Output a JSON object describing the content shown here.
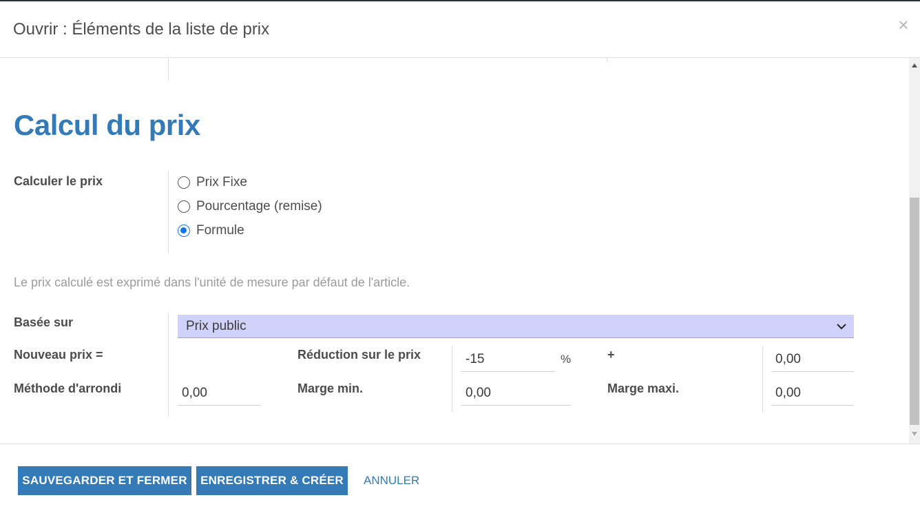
{
  "dialog": {
    "title": "Ouvrir : Éléments de la liste de prix",
    "close_icon": "×"
  },
  "section": {
    "title": "Calcul du prix"
  },
  "compute_price": {
    "label": "Calculer le prix",
    "options": [
      {
        "label": "Prix Fixe",
        "checked": false
      },
      {
        "label": "Pourcentage (remise)",
        "checked": false
      },
      {
        "label": "Formule",
        "checked": true
      }
    ]
  },
  "hint": "Le prix calculé est exprimé dans l'unité de mesure par défaut de l'article.",
  "based_on": {
    "label": "Basée sur",
    "value": "Prix public"
  },
  "formula": {
    "new_price_label": "Nouveau prix =",
    "discount_label": "Réduction sur le prix",
    "discount_value": "-15",
    "percent_sign": "%",
    "plus_sign": "+",
    "surcharge_value": "0,00",
    "rounding_label": "Méthode d'arrondi",
    "rounding_value": "0,00",
    "min_margin_label": "Marge min.",
    "min_margin_value": "0,00",
    "max_margin_label": "Marge maxi.",
    "max_margin_value": "0,00"
  },
  "footer": {
    "save_close": "SAUVEGARDER ET FERMER",
    "save_new": "ENREGISTRER & CRÉER",
    "cancel": "ANNULER"
  },
  "colors": {
    "accent": "#337ab7",
    "select_bg": "#d0d2fb",
    "radio_checked": "#1a73e8"
  }
}
